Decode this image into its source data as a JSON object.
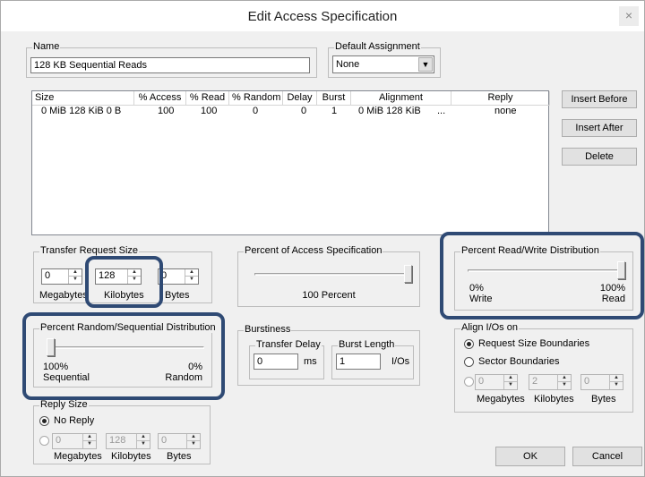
{
  "window": {
    "title": "Edit Access Specification",
    "close_label": "×"
  },
  "name_group": {
    "label": "Name",
    "value": "128 KB Sequential Reads"
  },
  "default_assignment": {
    "label": "Default Assignment",
    "value": "None",
    "arrow": "▼"
  },
  "table": {
    "headers": [
      "Size",
      "% Access",
      "% Read",
      "% Random",
      "Delay",
      "Burst",
      "Alignment",
      "Reply"
    ],
    "row": {
      "size": "0 MiB  128 KiB   0 B",
      "access": "100",
      "read": "100",
      "random": "0",
      "delay": "0",
      "burst": "1",
      "alignment": "0 MiB  128 KiB",
      "ellipsis": "...",
      "reply": "none"
    }
  },
  "buttons": {
    "insert_before": "Insert Before",
    "insert_after": "Insert After",
    "delete": "Delete",
    "ok": "OK",
    "cancel": "Cancel"
  },
  "transfer_size": {
    "label": "Transfer Request Size",
    "megabytes": "0",
    "kilobytes": "128",
    "bytes": "0",
    "mb_label": "Megabytes",
    "kb_label": "Kilobytes",
    "b_label": "Bytes"
  },
  "percent_access": {
    "label": "Percent of Access Specification",
    "value_text": "100 Percent",
    "level": 1.0
  },
  "read_write": {
    "label": "Percent Read/Write Distribution",
    "left_pct": "0%",
    "left_label": "Write",
    "right_pct": "100%",
    "right_label": "Read",
    "level": 1.0
  },
  "random_seq": {
    "label": "Percent Random/Sequential Distribution",
    "left_pct": "100%",
    "left_label": "Sequential",
    "right_pct": "0%",
    "right_label": "Random",
    "level": 0.0
  },
  "burstiness": {
    "label": "Burstiness",
    "transfer_delay_label": "Transfer Delay",
    "transfer_delay_value": "0",
    "transfer_delay_unit": "ms",
    "burst_length_label": "Burst Length",
    "burst_length_value": "1",
    "burst_length_unit": "I/Os"
  },
  "align": {
    "label": "Align I/Os on",
    "opt1": "Request Size Boundaries",
    "opt2": "Sector Boundaries",
    "megabytes": "0",
    "kilobytes": "2",
    "bytes": "0",
    "mb_label": "Megabytes",
    "kb_label": "Kilobytes",
    "b_label": "Bytes"
  },
  "reply_size": {
    "label": "Reply Size",
    "opt1": "No Reply",
    "megabytes": "0",
    "kilobytes": "128",
    "bytes": "0",
    "mb_label": "Megabytes",
    "kb_label": "Kilobytes",
    "b_label": "Bytes"
  },
  "spin_arrows": {
    "up": "▲",
    "down": "▼"
  },
  "colors": {
    "highlight": "#2f4a74",
    "dialog_bg": "#f0f0f0"
  }
}
